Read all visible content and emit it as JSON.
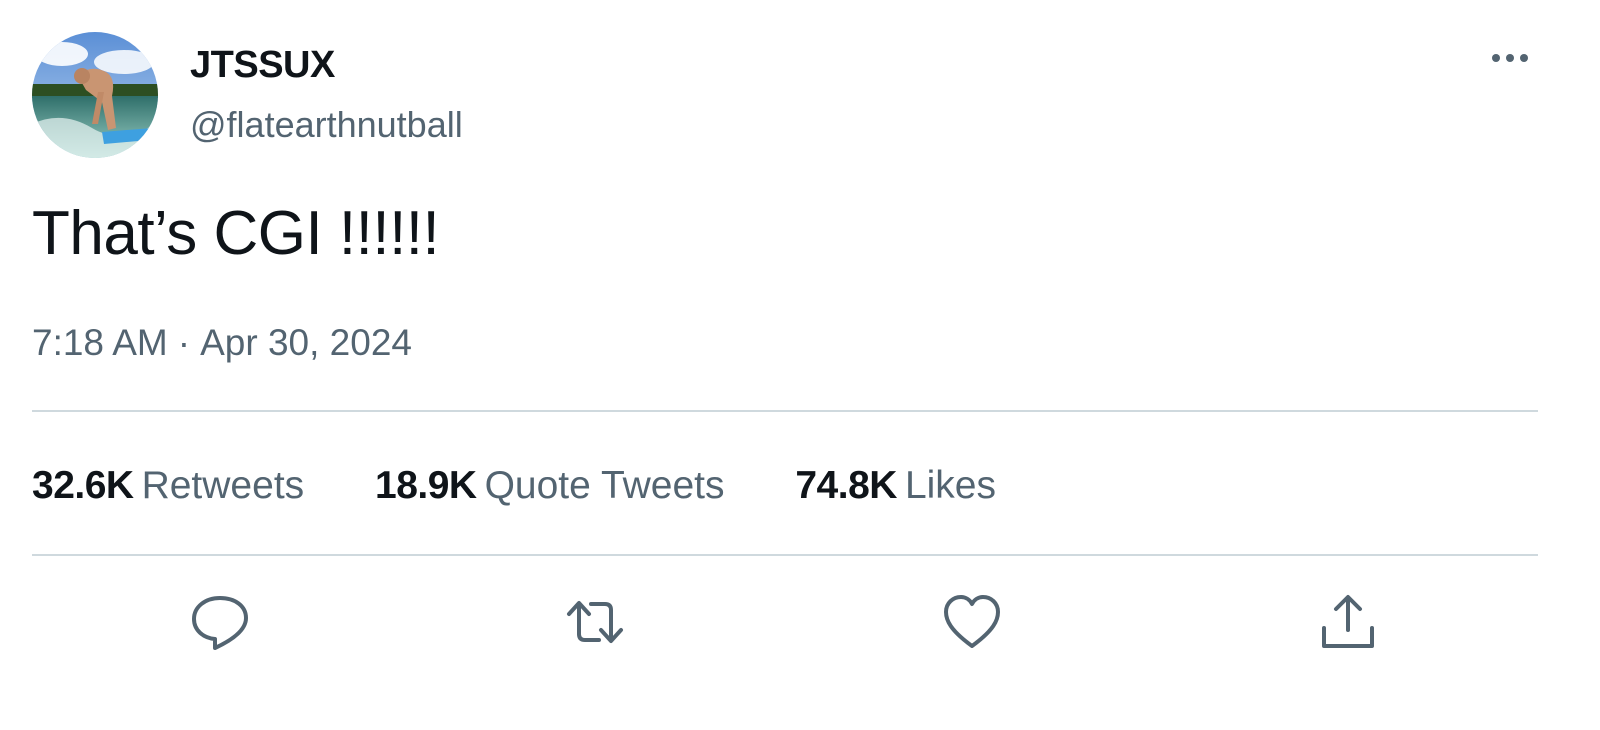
{
  "author": {
    "display_name": "JTSSUX",
    "handle": "@flatearthnutball",
    "avatar_icon": "surfer-avatar"
  },
  "tweet": {
    "text": "That’s CGI !!!!!!",
    "time": "7:18 AM",
    "separator": "·",
    "date": "Apr 30, 2024"
  },
  "stats": {
    "retweets": {
      "count": "32.6K",
      "label": "Retweets"
    },
    "quote_tweets": {
      "count": "18.9K",
      "label": "Quote Tweets"
    },
    "likes": {
      "count": "74.8K",
      "label": "Likes"
    }
  },
  "actions": {
    "reply_icon": "reply-icon",
    "retweet_icon": "retweet-icon",
    "like_icon": "heart-icon",
    "share_icon": "share-icon",
    "more_icon": "more-icon"
  },
  "colors": {
    "text_primary": "#0f1419",
    "text_secondary": "#536471",
    "divider": "#cfd9de",
    "icon": "#536471"
  }
}
